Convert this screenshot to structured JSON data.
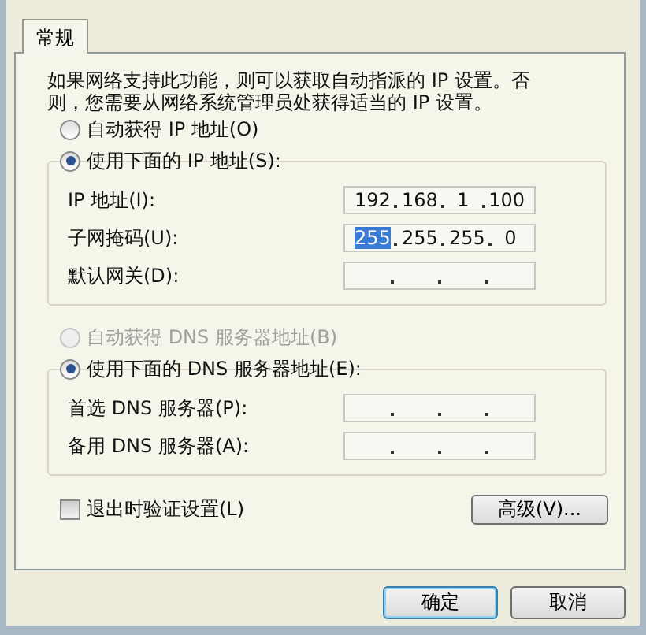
{
  "tabs": [
    {
      "label": "常规",
      "selected": true
    }
  ],
  "intro": "如果网络支持此功能，则可以获取自动指派的 IP 设置。否则，您需要从网络系统管理员处获得适当的 IP 设置。",
  "ip_group": {
    "options": [
      {
        "label": "自动获得 IP 地址(O)",
        "selected": false,
        "disabled": false
      },
      {
        "label": "使用下面的 IP 地址(S):",
        "selected": true,
        "disabled": false
      }
    ],
    "fields": [
      {
        "label": "IP 地址(I):",
        "octets": [
          {
            "text": "192",
            "selected": false
          },
          {
            "text": "168",
            "selected": false
          },
          {
            "text": "1",
            "selected": false
          },
          {
            "text": "100",
            "selected": false
          }
        ]
      },
      {
        "label": "子网掩码(U):",
        "octets": [
          {
            "text": "255",
            "selected": true
          },
          {
            "text": "255",
            "selected": false
          },
          {
            "text": "255",
            "selected": false
          },
          {
            "text": "0",
            "selected": false
          }
        ]
      },
      {
        "label": "默认网关(D):"
      }
    ]
  },
  "dns_group": {
    "options": [
      {
        "label": "自动获得 DNS 服务器地址(B)",
        "selected": false,
        "disabled": true
      },
      {
        "label": "使用下面的 DNS 服务器地址(E):",
        "selected": true,
        "disabled": false
      }
    ],
    "fields": [
      {
        "label": "首选 DNS 服务器(P):"
      },
      {
        "label": "备用 DNS 服务器(A):"
      }
    ]
  },
  "validate": {
    "label": "退出时验证设置(L)",
    "checked": false
  },
  "advanced_button": "高级(V)...",
  "buttons": [
    {
      "label": "确定",
      "default": true
    },
    {
      "label": "取消",
      "default": false
    }
  ]
}
